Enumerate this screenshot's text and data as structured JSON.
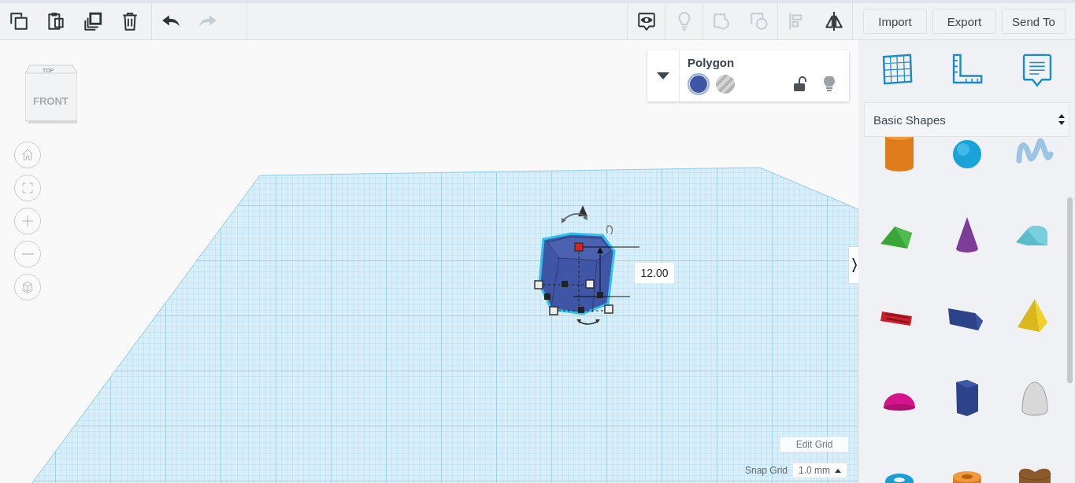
{
  "toolbar": {
    "edit_tools": [
      {
        "kind": "copy",
        "disabled": false
      },
      {
        "kind": "paste",
        "disabled": false
      },
      {
        "kind": "duplicate",
        "disabled": false
      },
      {
        "kind": "delete",
        "disabled": false
      }
    ],
    "history_tools": [
      {
        "kind": "undo",
        "disabled": false
      },
      {
        "kind": "redo",
        "disabled": true
      }
    ],
    "view_tool_groups": [
      {
        "tools": [
          {
            "kind": "show-all",
            "disabled": false
          }
        ]
      },
      {
        "tools": [
          {
            "kind": "bulb",
            "disabled": true
          }
        ]
      },
      {
        "tools": [
          {
            "kind": "group",
            "disabled": true
          },
          {
            "kind": "ungroup",
            "disabled": true
          }
        ]
      },
      {
        "tools": [
          {
            "kind": "align",
            "disabled": true
          },
          {
            "kind": "mirror",
            "disabled": false
          }
        ]
      }
    ],
    "buttons": [
      "Import",
      "Export",
      "Send To"
    ]
  },
  "view_cube": {
    "top_label": "TOP",
    "front_label": "FRONT"
  },
  "nav_buttons": [
    {
      "kind": "home"
    },
    {
      "kind": "fit"
    },
    {
      "kind": "zoom-in"
    },
    {
      "kind": "zoom-out"
    },
    {
      "kind": "ortho"
    }
  ],
  "inspector": {
    "title": "Polygon",
    "swatches": [
      {
        "kind": "solid",
        "color": "#3f55a5",
        "selected": true
      },
      {
        "kind": "hole",
        "selected": false
      }
    ],
    "locked": false
  },
  "dimension": "12.00",
  "grid_controls": {
    "edit_label": "Edit Grid",
    "snap_label": "Snap Grid",
    "snap_value": "1.0 mm"
  },
  "panel": {
    "tools": [
      {
        "kind": "workplane"
      },
      {
        "kind": "ruler"
      },
      {
        "kind": "notes"
      }
    ],
    "library": "Basic Shapes",
    "shapes": [
      {
        "kind": "cylinder"
      },
      {
        "kind": "sphere"
      },
      {
        "kind": "scribble"
      },
      {
        "kind": "roof"
      },
      {
        "kind": "cone"
      },
      {
        "kind": "round-roof"
      },
      {
        "kind": "text"
      },
      {
        "kind": "wedge"
      },
      {
        "kind": "pyramid"
      },
      {
        "kind": "half-sphere"
      },
      {
        "kind": "polygon"
      },
      {
        "kind": "paraboloid"
      },
      {
        "kind": "torus"
      },
      {
        "kind": "tube"
      },
      {
        "kind": "heart"
      }
    ]
  }
}
